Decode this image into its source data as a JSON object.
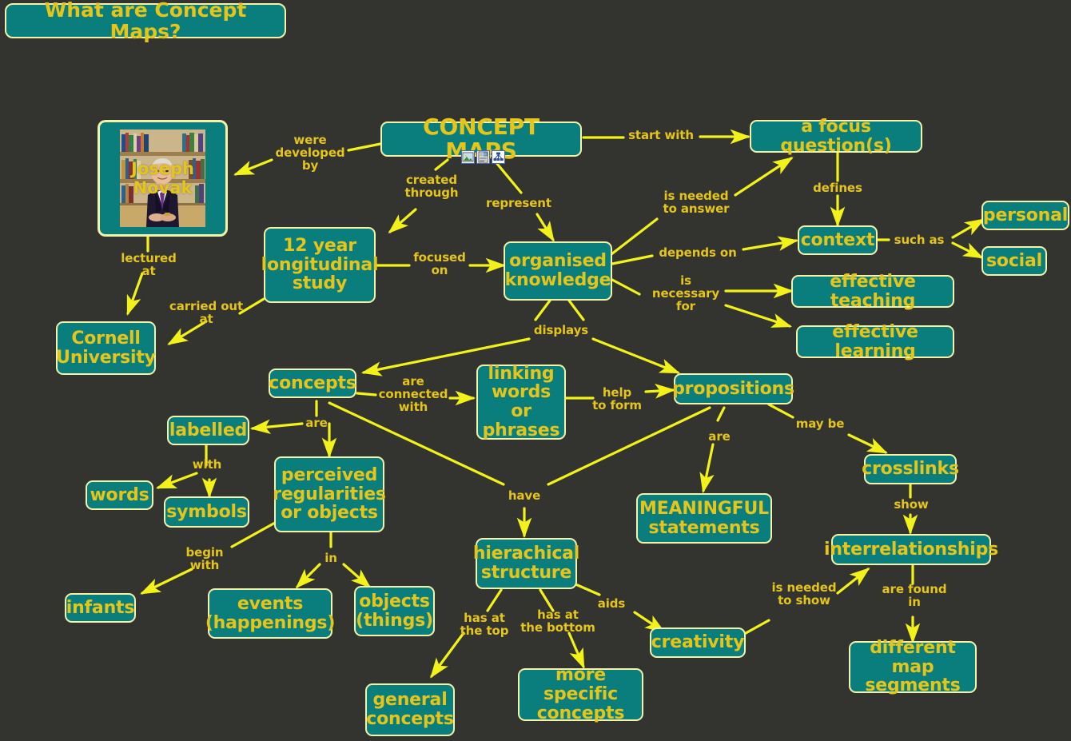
{
  "page": {
    "title": "What are Concept Maps?",
    "background_color": "#333330",
    "node_fill": "#0a7d7d",
    "node_border": "#f4f2a6",
    "text_color": "#e6c51a",
    "link_color": "#f2f21a"
  },
  "nodes": {
    "title": "What are Concept Maps?",
    "concept_maps": "CONCEPT MAPS",
    "joseph_novak": "Joseph Novak",
    "focus_question": "a focus question(s)",
    "context": "context",
    "personal": "personal",
    "social": "social",
    "effective_teaching": "effective teaching",
    "effective_learning": "effective learning",
    "longitudinal_study": "12 year\nlongitudinal\nstudy",
    "organised_knowledge": "organised\nknowledge",
    "cornell": "Cornell\nUniversity",
    "concepts": "concepts",
    "linking_words": "linking\nwords or\nphrases",
    "propositions": "propositions",
    "labelled": "labelled",
    "words": "words",
    "symbols": "symbols",
    "perceived": "perceived\nregularities\nor objects",
    "infants": "infants",
    "events": "events\n(happenings)",
    "objects": "objects\n(things)",
    "hierachical": "hierachical\nstructure",
    "general_concepts": "general\nconcepts",
    "more_specific": "more specific\nconcepts",
    "meaningful": "MEANINGFUL\nstatements",
    "creativity": "creativity",
    "crosslinks": "crosslinks",
    "interrelationships": "interrelationships",
    "different_map_segments": "different map\nsegments"
  },
  "link_labels": {
    "were_developed_by": "were\ndeveloped\nby",
    "created_through": "created\nthrough",
    "represent": "represent",
    "start_with": "start with",
    "defines": "defines",
    "such_as": "such as",
    "is_needed_to_answer": "is needed\nto answer",
    "depends_on": "depends on",
    "is_necessary_for": "is\nnecessary\nfor",
    "lectured_at": "lectured\nat",
    "carried_out_at": "carried out\nat",
    "focused_on": "focused\non",
    "displays": "displays",
    "are_connected_with": "are\nconnected\nwith",
    "help_to_form": "help\nto form",
    "are_labelled": "are",
    "with": "with",
    "begin_with": "begin\nwith",
    "in": "in",
    "have": "have",
    "has_at_the_top": "has at\nthe top",
    "has_at_the_bottom": "has at\nthe bottom",
    "aids": "aids",
    "are_propositions": "are",
    "may_be": "may be",
    "show": "show",
    "is_needed_to_show": "is needed\nto show",
    "are_found_in": "are found\nin"
  },
  "resource_icons": [
    {
      "name": "image-resource-icon",
      "title": "image"
    },
    {
      "name": "document-resource-icon",
      "title": "document"
    },
    {
      "name": "concept-map-resource-icon",
      "title": "concept map"
    }
  ]
}
